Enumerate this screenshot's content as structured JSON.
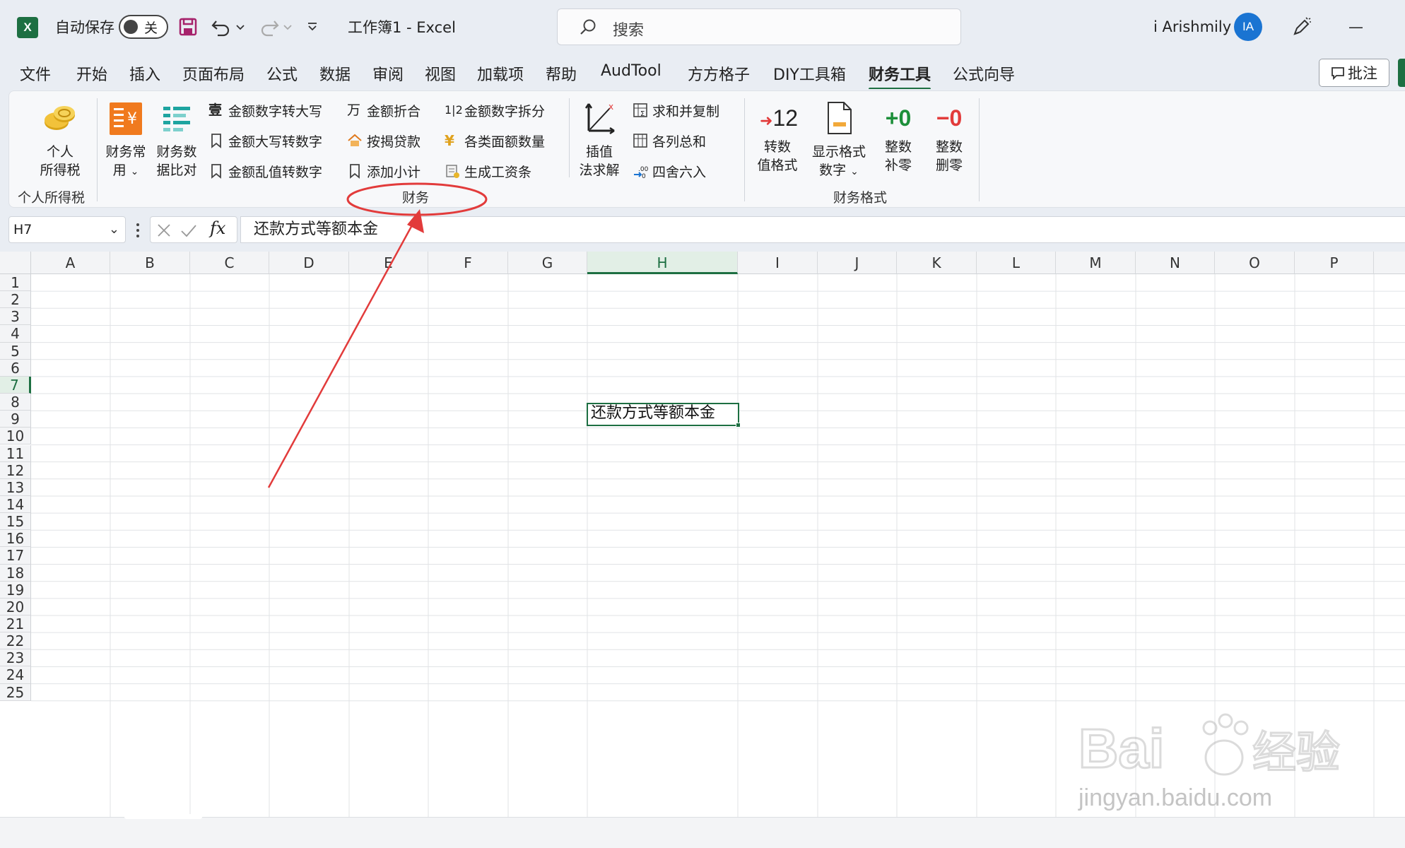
{
  "titlebar": {
    "app_logo": "X",
    "autosave_label": "自动保存",
    "autosave_state": "关",
    "doc_title": "工作簿1 - Excel",
    "search_placeholder": "搜索",
    "user_name": "i Arishmily",
    "avatar_initials": "IA",
    "minimize": "—"
  },
  "menu": {
    "tabs": [
      "文件",
      "开始",
      "插入",
      "页面布局",
      "公式",
      "数据",
      "审阅",
      "视图",
      "加载项",
      "帮助",
      "AudTool",
      "方方格子",
      "DIY工具箱",
      "财务工具",
      "公式向导"
    ],
    "active_tab": "财务工具",
    "comment_button": "批注"
  },
  "ribbon": {
    "personal_tax": {
      "label_line1": "个人",
      "label_line2": "所得税",
      "group_label": "个人所得税"
    },
    "finance_common": {
      "line1": "财务常",
      "line2": "用"
    },
    "finance_compare": {
      "line1": "财务数",
      "line2": "据比对"
    },
    "col1": [
      "金额数字转大写",
      "金额大写转数字",
      "金额乱值转数字"
    ],
    "col2": [
      "金额折合",
      "按揭贷款",
      "添加小计"
    ],
    "col3": [
      "金额数字拆分",
      "各类面额数量",
      "生成工资条"
    ],
    "finance_group_label": "财务",
    "interp": {
      "line1": "插值",
      "line2": "法求解"
    },
    "col4": [
      "求和并复制",
      "各列总和",
      "四舍六入"
    ],
    "convert_fmt": {
      "icon_text": "12",
      "line1": "转数",
      "line2": "值格式"
    },
    "show_fmt": {
      "line1": "显示格式",
      "line2": "数字"
    },
    "round_up": {
      "icon_text": "+0",
      "line1": "整数",
      "line2": "补零"
    },
    "round_del": {
      "icon_text": "−0",
      "line1": "整数",
      "line2": "删零"
    },
    "fmt_group_label": "财务格式"
  },
  "formula_bar": {
    "name_box": "H7",
    "fx": "fx",
    "content": "还款方式等额本金"
  },
  "sheet": {
    "columns": [
      "A",
      "B",
      "C",
      "D",
      "E",
      "F",
      "G",
      "H",
      "I",
      "J",
      "K",
      "L",
      "M",
      "N",
      "O",
      "P"
    ],
    "rows": [
      "1",
      "2",
      "3",
      "4",
      "5",
      "6",
      "7",
      "8",
      "9",
      "10",
      "11",
      "12",
      "13",
      "14",
      "15",
      "16",
      "17",
      "18",
      "19",
      "20",
      "21",
      "22",
      "23",
      "24",
      "25"
    ],
    "selected_column": "H",
    "selected_row": "7",
    "active_cell_value": "还款方式等额本金"
  },
  "watermark": {
    "brand": "Bai",
    "brand2": "经验",
    "url": "jingyan.baidu.com"
  },
  "colors": {
    "excel_green": "#1d6f42",
    "annotation_red": "#e23b3b",
    "avatar_blue": "#1a74d2"
  }
}
